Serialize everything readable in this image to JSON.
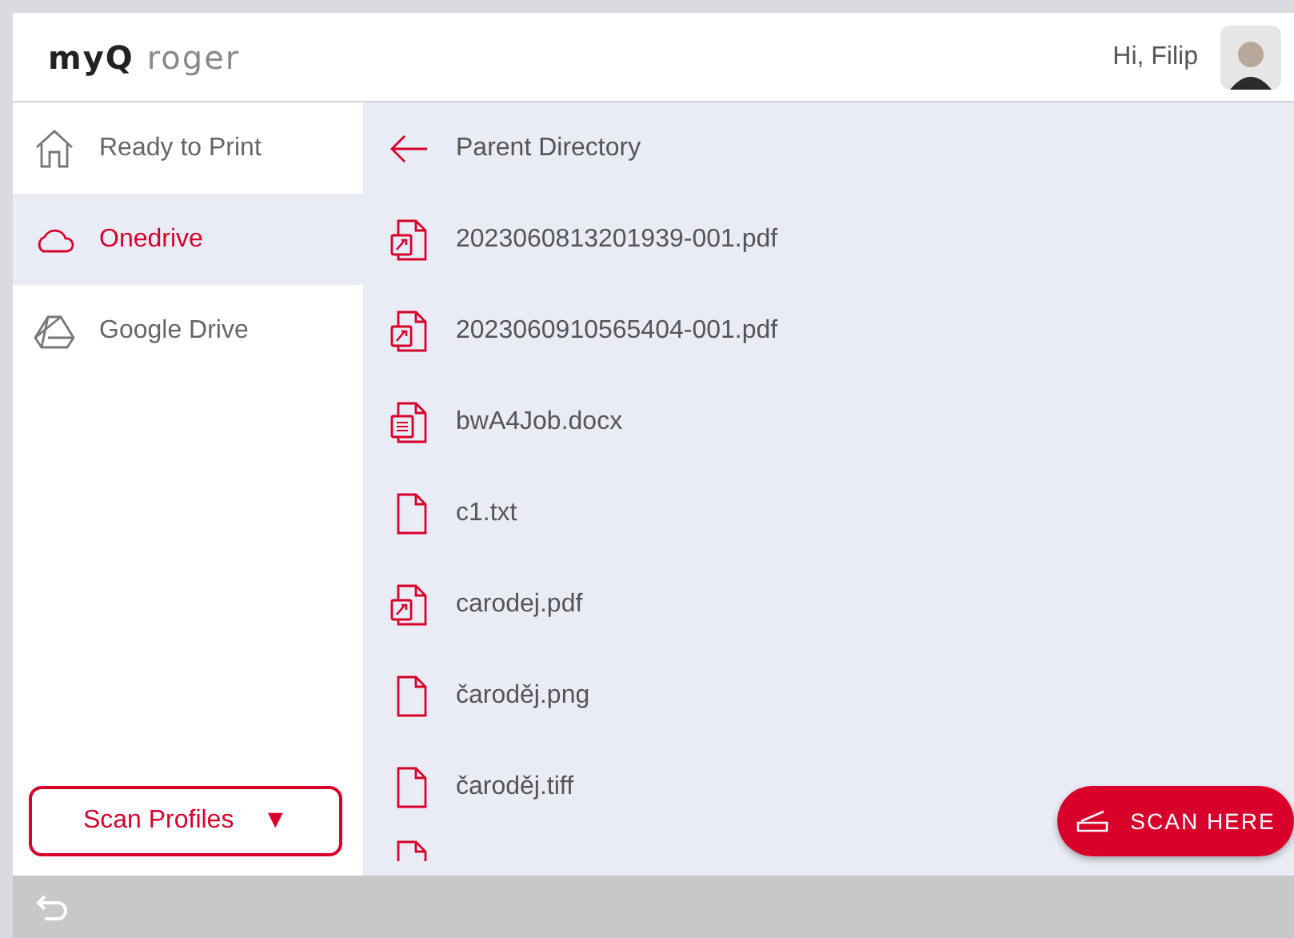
{
  "header": {
    "logo_brand": "myQ",
    "logo_product": "roger",
    "greeting": "Hi, Filip"
  },
  "sidebar": {
    "items": [
      {
        "label": "Ready to Print",
        "selected": false
      },
      {
        "label": "Onedrive",
        "selected": true
      },
      {
        "label": "Google Drive",
        "selected": false
      }
    ],
    "scan_profiles": {
      "label": "Scan Profiles",
      "caret": "▼"
    }
  },
  "files": {
    "parent": "Parent Directory",
    "items": [
      {
        "name": "2023060813201939-001.pdf",
        "kind": "pdf"
      },
      {
        "name": "2023060910565404-001.pdf",
        "kind": "pdf"
      },
      {
        "name": "bwA4Job.docx",
        "kind": "doc"
      },
      {
        "name": "c1.txt",
        "kind": "file"
      },
      {
        "name": "carodej.pdf",
        "kind": "pdf"
      },
      {
        "name": "čaroděj.png",
        "kind": "file"
      },
      {
        "name": "čaroděj.tiff",
        "kind": "file"
      }
    ]
  },
  "scan_button": {
    "label": "SCAN HERE"
  }
}
